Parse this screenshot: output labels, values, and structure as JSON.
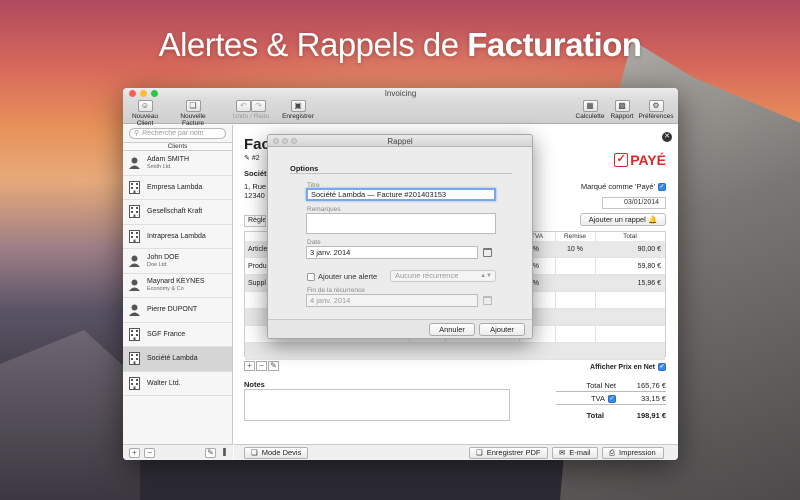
{
  "headline": {
    "light": "Alertes & Rappels de",
    "bold": "Facturation"
  },
  "window": {
    "title": "Invoicing"
  },
  "toolbar": {
    "new_client": "Nouveau Client",
    "new_invoice": "Nouvelle Facture",
    "undo_redo": "Undo / Redo",
    "save": "Enregistrer",
    "calculator": "Calculette",
    "report": "Rapport",
    "preferences": "Préférences"
  },
  "sidebar": {
    "search_placeholder": "Recherche par nom",
    "clients_header": "Clients",
    "clients": [
      {
        "name": "Adam SMITH",
        "sub": "Smith Ltd.",
        "kind": "person"
      },
      {
        "name": "Empresa Lambda",
        "sub": "",
        "kind": "company"
      },
      {
        "name": "Gesellschaft Kraft",
        "sub": "",
        "kind": "company"
      },
      {
        "name": "Intrapresa Lambda",
        "sub": "",
        "kind": "company"
      },
      {
        "name": "John DOE",
        "sub": "Doe Ltd.",
        "kind": "person"
      },
      {
        "name": "Maynard KEYNES",
        "sub": "Economy & Co",
        "kind": "person"
      },
      {
        "name": "Pierre DUPONT",
        "sub": "",
        "kind": "person"
      },
      {
        "name": "SGF France",
        "sub": "",
        "kind": "company"
      },
      {
        "name": "Société Lambda",
        "sub": "",
        "kind": "company",
        "selected": true
      },
      {
        "name": "Walter Ltd.",
        "sub": "",
        "kind": "company"
      }
    ]
  },
  "invoice": {
    "title_visible": "Fac",
    "number_visible": "#2",
    "paid_stamp": "PAYÉ",
    "company_visible": "Sociét",
    "address_line1_visible": "1, Rue",
    "address_line2_visible": "12340",
    "marked_paid": "Marqué comme 'Payé'",
    "date": "03/01/2014",
    "add_reminder": "Ajouter un rappel",
    "payment_visible": "Règle",
    "columns": {
      "tva": "TVA",
      "remise": "Remise",
      "total": "Total"
    },
    "rows": [
      {
        "label_visible": "Article",
        "tva": "20 %",
        "remise": "10 %",
        "total": "90,00 €"
      },
      {
        "label_visible": "Produ",
        "tva": "20 %",
        "remise": "",
        "total": "59,80 €"
      },
      {
        "label_visible": "Suppl",
        "tva": "20 %",
        "remise": "",
        "total": "15,96 €"
      }
    ],
    "show_net_prices": "Afficher Prix en Net",
    "notes_label": "Notes",
    "totals": {
      "net_label": "Total Net",
      "net_value": "165,76 €",
      "tva_label": "TVA",
      "tva_value": "33,15 €",
      "total_label": "Total",
      "total_value": "198,91 €"
    },
    "footer": {
      "quote_mode": "Mode Devis",
      "save_pdf": "Enregistrer PDF",
      "email": "E-mail",
      "print": "Impression"
    }
  },
  "dialog": {
    "title": "Rappel",
    "section": "Options",
    "title_label": "Titre",
    "title_value": "Société Lambda — Facture #201403153",
    "remarks_label": "Remarques",
    "date_label": "Date",
    "date_value": "3 janv. 2014",
    "add_alert": "Ajouter une alerte",
    "recurrence_value": "Aucune récurrence",
    "recurrence_end_label": "Fin de la récurrence",
    "recurrence_end_value": "4 janv. 2014",
    "cancel": "Annuler",
    "add": "Ajouter"
  },
  "colors": {
    "accent": "#3b87e6",
    "paid_red": "#d62b2b",
    "selection": "#d5d5d5"
  }
}
